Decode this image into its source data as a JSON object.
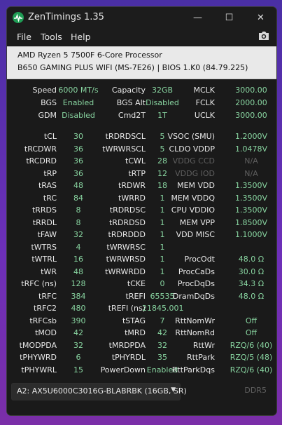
{
  "window": {
    "title": "ZenTimings 1.35"
  },
  "controls": {
    "minimize": "—",
    "maximize": "☐",
    "close": "✕"
  },
  "menu": {
    "file": "File",
    "tools": "Tools",
    "help": "Help"
  },
  "system": {
    "cpu": "AMD Ryzen 5 7500F 6-Core Processor",
    "board": "B650 GAMING PLUS WIFI (MS-7E26) | BIOS 1.K0 (84.79.225)"
  },
  "top": {
    "speed": {
      "label": "Speed",
      "value": "6000 MT/s"
    },
    "capacity": {
      "label": "Capacity",
      "value": "32GB"
    },
    "mclk": {
      "label": "MCLK",
      "value": "3000.00"
    },
    "bgs": {
      "label": "BGS",
      "value": "Enabled"
    },
    "bgs_alt": {
      "label": "BGS Alt",
      "value": "Disabled"
    },
    "fclk": {
      "label": "FCLK",
      "value": "2000.00"
    },
    "gdm": {
      "label": "GDM",
      "value": "Disabled"
    },
    "cmd2t": {
      "label": "Cmd2T",
      "value": "1T"
    },
    "uclk": {
      "label": "UCLK",
      "value": "3000.00"
    }
  },
  "col1": [
    {
      "label": "tCL",
      "value": "30"
    },
    {
      "label": "tRCDWR",
      "value": "36"
    },
    {
      "label": "tRCDRD",
      "value": "36"
    },
    {
      "label": "tRP",
      "value": "36"
    },
    {
      "label": "tRAS",
      "value": "48"
    },
    {
      "label": "tRC",
      "value": "84"
    },
    {
      "label": "tRRDS",
      "value": "8"
    },
    {
      "label": "tRRDL",
      "value": "8"
    },
    {
      "label": "tFAW",
      "value": "32"
    },
    {
      "label": "tWTRS",
      "value": "4"
    },
    {
      "label": "tWTRL",
      "value": "16"
    },
    {
      "label": "tWR",
      "value": "48"
    },
    {
      "label": "tRFC (ns)",
      "value": "128"
    },
    {
      "label": "tRFC",
      "value": "384"
    },
    {
      "label": "tRFC2",
      "value": "480"
    },
    {
      "label": "tRFCsb",
      "value": "390"
    },
    {
      "label": "tMOD",
      "value": "42"
    },
    {
      "label": "tMODPDA",
      "value": "32"
    },
    {
      "label": "tPHYWRD",
      "value": "6"
    },
    {
      "label": "tPHYWRL",
      "value": "15"
    }
  ],
  "col2": [
    {
      "label": "tRDRDSCL",
      "value": "5"
    },
    {
      "label": "tWRWRSCL",
      "value": "5"
    },
    {
      "label": "tCWL",
      "value": "28"
    },
    {
      "label": "tRTP",
      "value": "12"
    },
    {
      "label": "tRDWR",
      "value": "18"
    },
    {
      "label": "tWRRD",
      "value": "1"
    },
    {
      "label": "tRDRDSC",
      "value": "1"
    },
    {
      "label": "tRDRDSD",
      "value": "1"
    },
    {
      "label": "tRDRDDD",
      "value": "1"
    },
    {
      "label": "tWRWRSC",
      "value": "1"
    },
    {
      "label": "tWRWRSD",
      "value": "1"
    },
    {
      "label": "tWRWRDD",
      "value": "1"
    },
    {
      "label": "tCKE",
      "value": "0"
    },
    {
      "label": "tREFI",
      "value": "65535"
    },
    {
      "label": "tREFI (ns)",
      "value": "21845.001"
    },
    {
      "label": "tSTAG",
      "value": "7"
    },
    {
      "label": "tMRD",
      "value": "42"
    },
    {
      "label": "tMRDPDA",
      "value": "32"
    },
    {
      "label": "tPHYRDL",
      "value": "35"
    },
    {
      "label": "PowerDown",
      "value": "Enabled"
    }
  ],
  "col3": [
    {
      "label": "VSOC (SMU)",
      "value": "1.2000V"
    },
    {
      "label": "CLDO VDDP",
      "value": "1.0478V"
    },
    {
      "label": "VDDG CCD",
      "value": "N/A"
    },
    {
      "label": "VDDG IOD",
      "value": "N/A"
    },
    {
      "label": "MEM VDD",
      "value": "1.3500V"
    },
    {
      "label": "MEM VDDQ",
      "value": "1.3500V"
    },
    {
      "label": "CPU VDDIO",
      "value": "1.3500V"
    },
    {
      "label": "MEM VPP",
      "value": "1.8500V"
    },
    {
      "label": "VDD MISC",
      "value": "1.1000V"
    },
    {
      "label": "",
      "value": ""
    },
    {
      "label": "ProcOdt",
      "value": "48.0 Ω"
    },
    {
      "label": "ProcCaDs",
      "value": "30.0 Ω"
    },
    {
      "label": "ProcDqDs",
      "value": "34.3 Ω"
    },
    {
      "label": "DramDqDs",
      "value": "48.0 Ω"
    },
    {
      "label": "",
      "value": ""
    },
    {
      "label": "RttNomWr",
      "value": "Off"
    },
    {
      "label": "RttNomRd",
      "value": "Off"
    },
    {
      "label": "RttWr",
      "value": "RZQ/6 (40)"
    },
    {
      "label": "RttPark",
      "value": "RZQ/5 (48)"
    },
    {
      "label": "RttParkDqs",
      "value": "RZQ/6 (40)"
    }
  ],
  "footer": {
    "dimm_selected": "A2: AX5U6000C3016G-BLABRBK (16GB, SR)",
    "ddr_type": "DDR5"
  }
}
